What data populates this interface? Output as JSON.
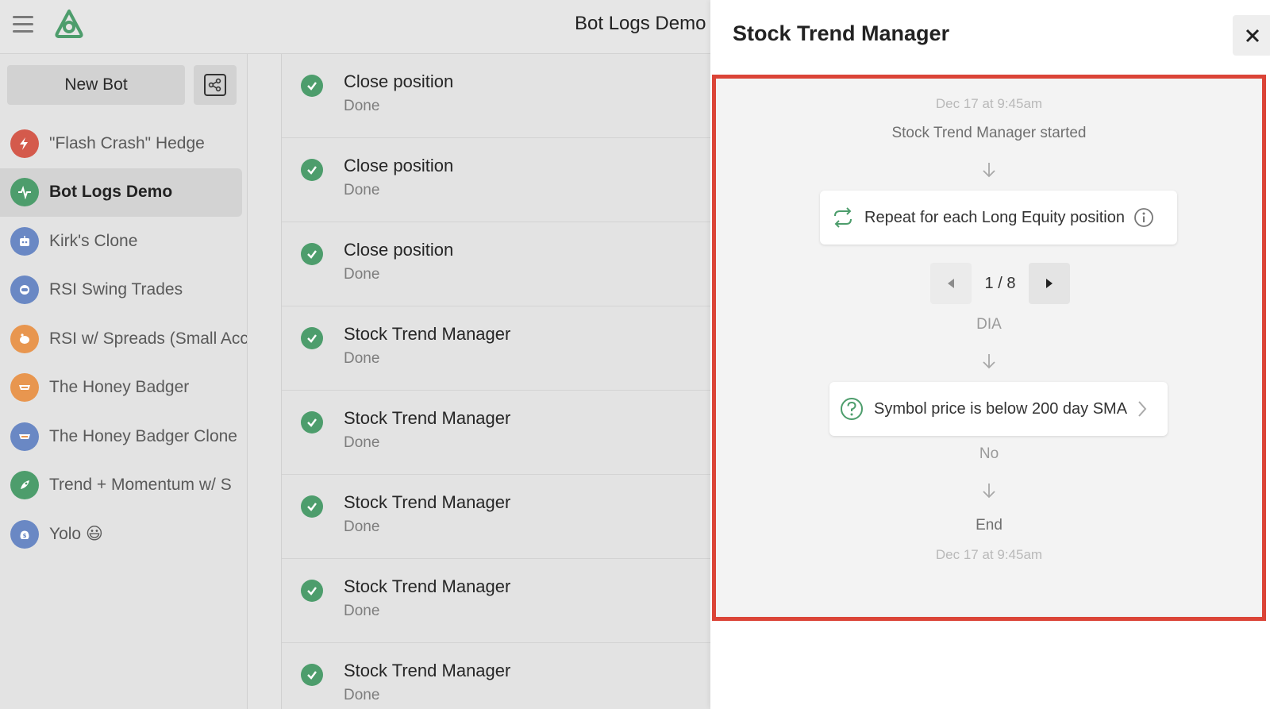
{
  "header": {
    "app_title": "Bot Logs Demo"
  },
  "sidebar": {
    "new_bot_label": "New Bot",
    "bots": [
      {
        "label": "\"Flash Crash\" Hedge",
        "color": "#d45a4c",
        "icon": "lightning-icon"
      },
      {
        "label": "Bot Logs Demo",
        "color": "#4d9d6c",
        "icon": "pulse-icon",
        "active": true
      },
      {
        "label": "Kirk's Clone",
        "color": "#6a88c4",
        "icon": "robot-icon"
      },
      {
        "label": "RSI Swing Trades",
        "color": "#6a88c4",
        "icon": "astronaut-icon"
      },
      {
        "label": "RSI w/ Spreads (Small Acc",
        "color": "#e8964f",
        "icon": "piggy-bank-icon"
      },
      {
        "label": "The Honey Badger",
        "color": "#e8964f",
        "icon": "badger-icon"
      },
      {
        "label": "The Honey Badger Clone",
        "color": "#6a88c4",
        "icon": "badger-icon"
      },
      {
        "label": "Trend + Momentum w/ S",
        "color": "#4d9d6c",
        "icon": "rocket-icon"
      },
      {
        "label": "Yolo 😃",
        "color": "#6a88c4",
        "icon": "money-bag-icon"
      }
    ]
  },
  "logs": [
    {
      "title": "Close position",
      "status": "Done"
    },
    {
      "title": "Close position",
      "status": "Done"
    },
    {
      "title": "Close position",
      "status": "Done"
    },
    {
      "title": "Stock Trend Manager",
      "status": "Done"
    },
    {
      "title": "Stock Trend Manager",
      "status": "Done"
    },
    {
      "title": "Stock Trend Manager",
      "status": "Done"
    },
    {
      "title": "Stock Trend Manager",
      "status": "Done"
    },
    {
      "title": "Stock Trend Manager",
      "status": "Done"
    }
  ],
  "drawer": {
    "title": "Stock Trend Manager",
    "start_time": "Dec 17 at 9:45am",
    "started_text": "Stock Trend Manager started",
    "repeat_label": "Repeat for each Long Equity position",
    "pager": {
      "current": "1",
      "sep": "/",
      "total": "8"
    },
    "symbol": "DIA",
    "condition_label": "Symbol price is below 200 day SMA",
    "condition_result": "No",
    "end_label": "End",
    "end_time": "Dec 17 at 9:45am"
  },
  "colors": {
    "accent_green": "#4d9d6c",
    "highlight_red": "#db4437"
  }
}
